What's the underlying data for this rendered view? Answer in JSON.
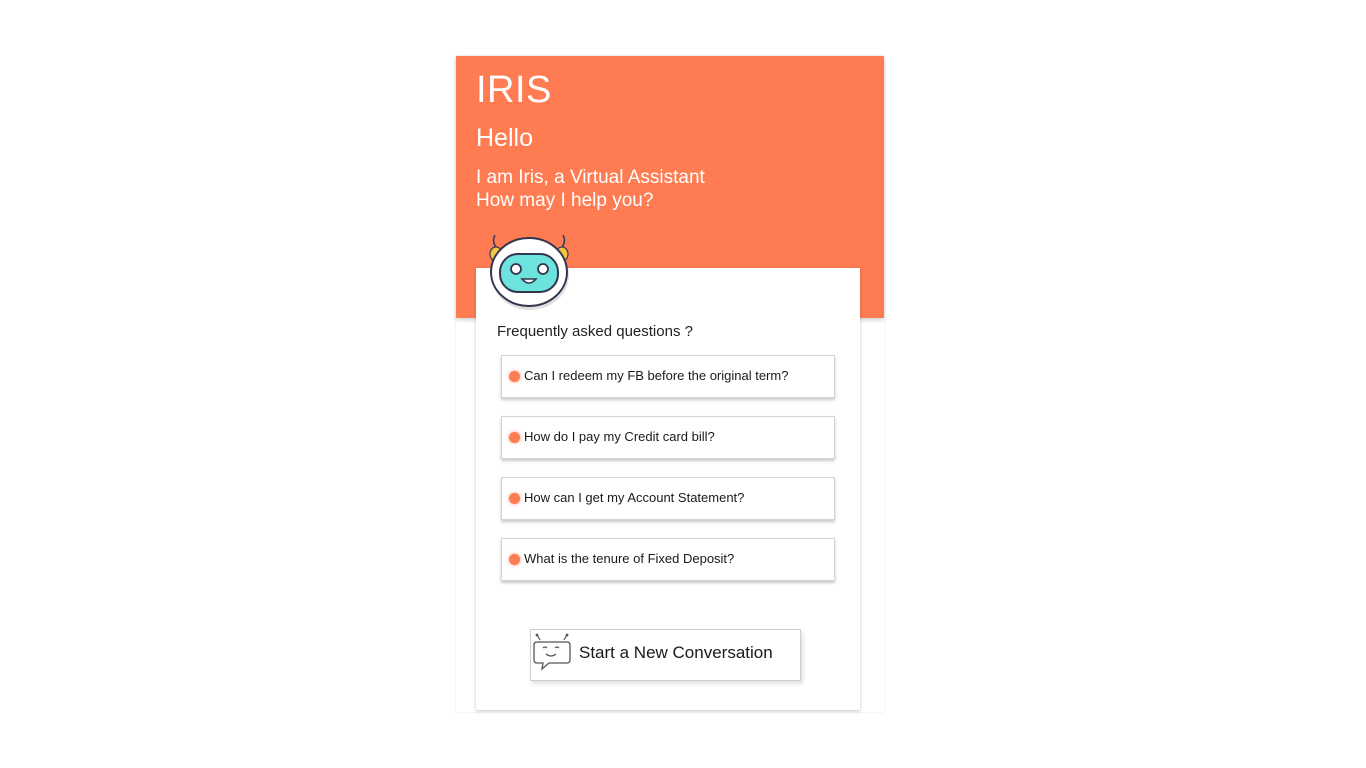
{
  "header": {
    "title": "IRIS",
    "greeting": "Hello",
    "intro_line1": "I am Iris, a Virtual Assistant",
    "intro_line2": "How may I help you?"
  },
  "colors": {
    "accent": "#ff7b52",
    "avatar_face": "#6ce3dc"
  },
  "icons": {
    "avatar": "robot-avatar-icon",
    "faq_bullet": "bullet-dot-icon",
    "new_conversation": "robot-chat-bubble-icon"
  },
  "faq": {
    "title": "Frequently asked questions ?",
    "items": [
      {
        "question": "Can I redeem my FB before the original term?"
      },
      {
        "question": "How do I pay my Credit card bill?"
      },
      {
        "question": "How can I get my Account Statement?"
      },
      {
        "question": "What is the tenure of Fixed Deposit?"
      }
    ]
  },
  "actions": {
    "new_conversation": "Start a New Conversation"
  }
}
